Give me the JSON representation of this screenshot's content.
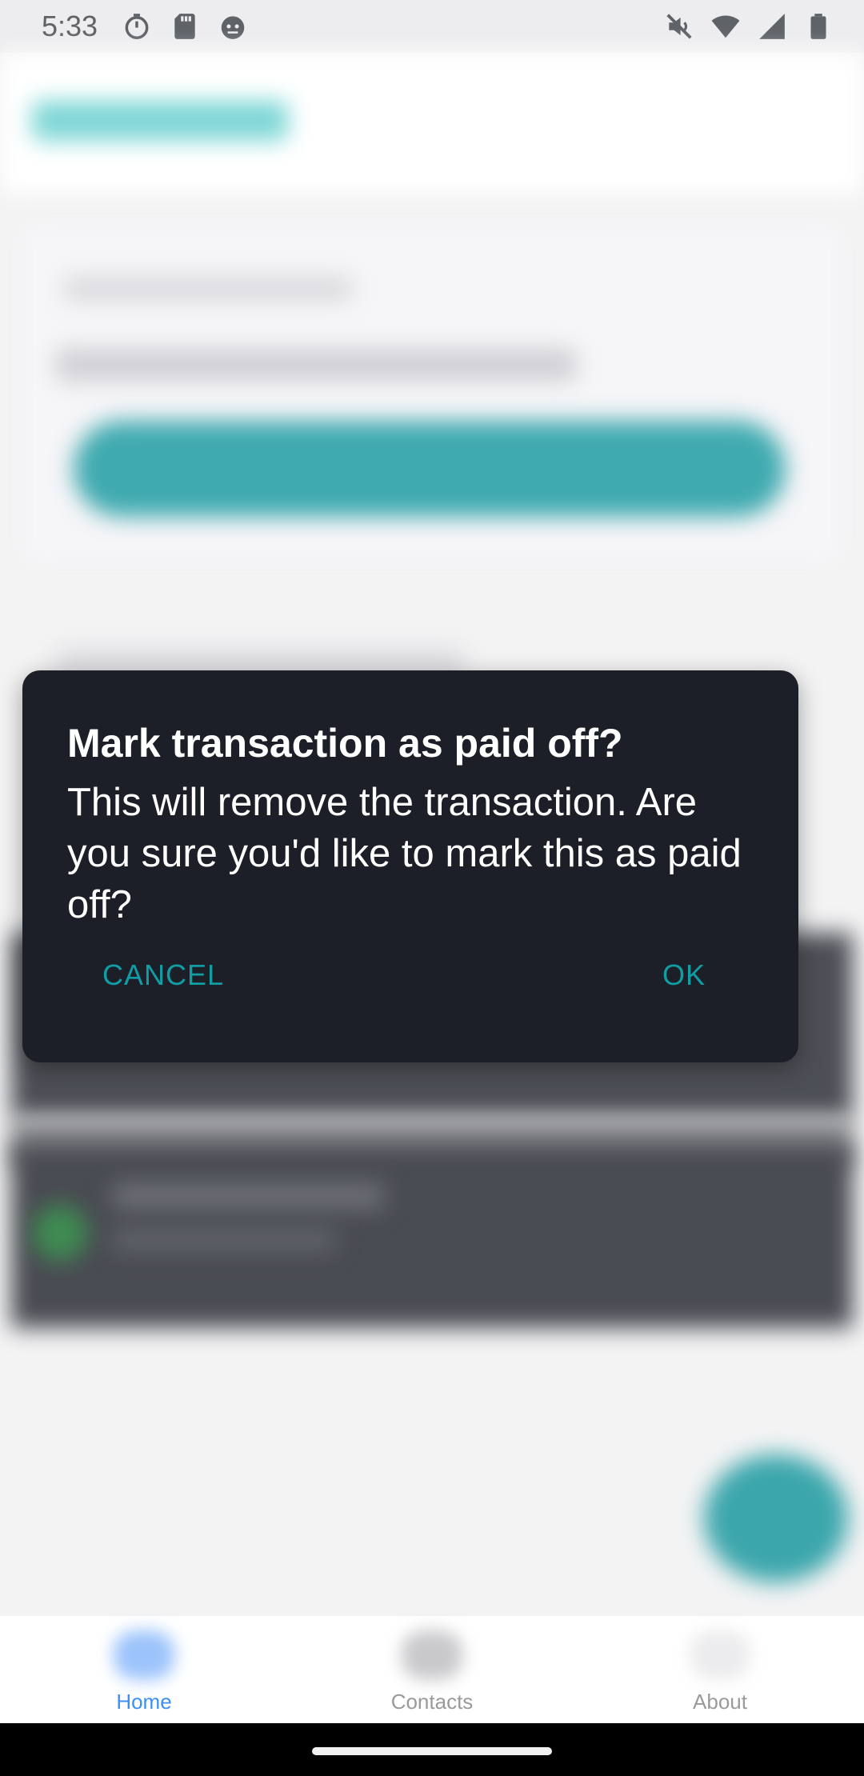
{
  "status_bar": {
    "time": "5:33",
    "left_icons": [
      "timer-icon",
      "sd-card-icon",
      "android-debug-icon"
    ],
    "right_icons": [
      "mute-icon",
      "wifi-icon",
      "signal-icon",
      "battery-icon"
    ]
  },
  "dialog": {
    "title": "Mark transaction as paid off?",
    "message": "This will remove the transaction. Are you sure you'd like to mark this as paid off?",
    "cancel_label": "CANCEL",
    "ok_label": "OK",
    "accent_color": "#119da4",
    "background_color": "#1c1f27"
  },
  "bottom_nav": {
    "items": [
      {
        "label": "Home",
        "icon": "home-icon",
        "active": true,
        "color": "#3b8ff5"
      },
      {
        "label": "Contacts",
        "icon": "contacts-icon",
        "active": false,
        "color": "#9a9a9a"
      },
      {
        "label": "About",
        "icon": "about-icon",
        "active": false,
        "color": "#9a9a9a"
      }
    ]
  },
  "colors": {
    "brand_teal": "#3faab0",
    "fab": "#3ba6ac"
  }
}
